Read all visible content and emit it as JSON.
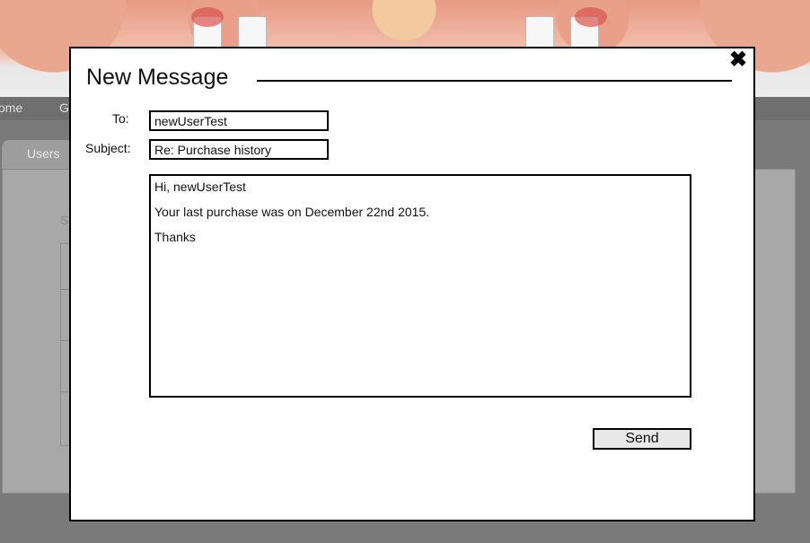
{
  "background": {
    "nav_items": [
      "ome",
      "G"
    ],
    "tab_label": "Users",
    "panel_label": "S"
  },
  "modal": {
    "title": "New Message",
    "close_glyph": "✖",
    "to_label": "To:",
    "to_value": "newUserTest",
    "subject_label": "Subject:",
    "subject_value": "Re: Purchase history",
    "body_lines": [
      "Hi, newUserTest",
      "Your last purchase was on December 22nd 2015.",
      "Thanks"
    ],
    "send_label": "Send"
  }
}
